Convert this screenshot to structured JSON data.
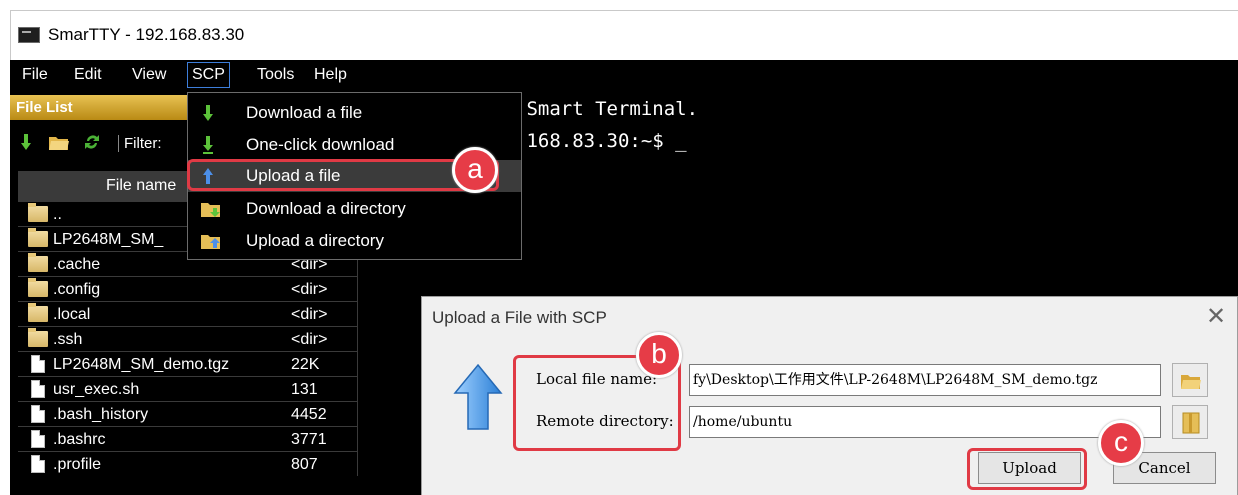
{
  "window": {
    "title": "SmarTTY - 192.168.83.30"
  },
  "menu": {
    "file": "File",
    "edit": "Edit",
    "view": "View",
    "scp": "SCP",
    "tools": "Tools",
    "help": "Help"
  },
  "file_list": {
    "header": "File List",
    "filter_label": "Filter:",
    "column_name": "File name",
    "rows": [
      {
        "name": "..",
        "size": "",
        "type": "folder"
      },
      {
        "name": "LP2648M_SM_",
        "size": "",
        "type": "folder"
      },
      {
        "name": ".cache",
        "size": "<dir>",
        "type": "folder"
      },
      {
        "name": ".config",
        "size": "<dir>",
        "type": "folder"
      },
      {
        "name": ".local",
        "size": "<dir>",
        "type": "folder"
      },
      {
        "name": ".ssh",
        "size": "<dir>",
        "type": "folder"
      },
      {
        "name": "LP2648M_SM_demo.tgz",
        "size": "22K",
        "type": "file"
      },
      {
        "name": "usr_exec.sh",
        "size": "131",
        "type": "file"
      },
      {
        "name": ".bash_history",
        "size": "4452",
        "type": "file"
      },
      {
        "name": ".bashrc",
        "size": "3771",
        "type": "file"
      },
      {
        "name": ".profile",
        "size": "807",
        "type": "file"
      }
    ]
  },
  "terminal": {
    "lines": [
      " Smart Terminal.",
      ".168.83.30:~$ _"
    ]
  },
  "scp_menu": {
    "items": [
      {
        "label": "Download a file",
        "icon": "download-arrow-icon"
      },
      {
        "label": "One-click download",
        "icon": "one-click-download-icon"
      },
      {
        "label": "Upload a file",
        "icon": "upload-arrow-icon",
        "highlighted": true
      },
      {
        "label": "Download a directory",
        "icon": "download-folder-icon"
      },
      {
        "label": "Upload a directory",
        "icon": "upload-folder-icon"
      }
    ]
  },
  "dialog": {
    "title": "Upload a File with SCP",
    "local_label": "Local file name:",
    "local_value": "fy\\Desktop\\工作用文件\\LP-2648M\\LP2648M_SM_demo.tgz",
    "remote_label": "Remote directory:",
    "remote_value": "/home/ubuntu",
    "upload_button": "Upload",
    "cancel_button": "Cancel"
  },
  "annotations": {
    "a": "a",
    "b": "b",
    "c": "c"
  },
  "colors": {
    "callout": "#e63c47",
    "highlight": "#3b3b3b",
    "accent": "#3d7edb"
  }
}
